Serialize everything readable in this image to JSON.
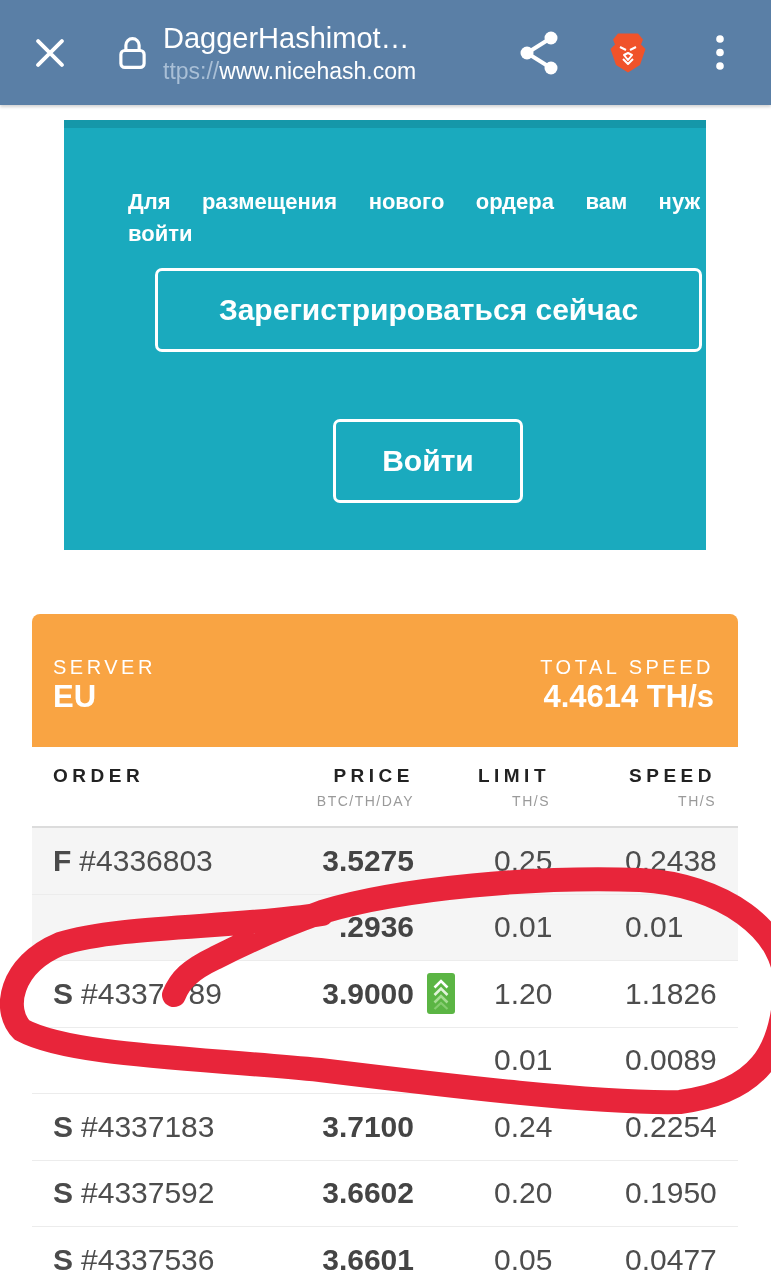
{
  "browser_bar": {
    "title": "DaggerHashimot…",
    "url_scheme": "ttps://",
    "url_host": "www.nicehash.com"
  },
  "banner": {
    "message_line_1": "Для размещения нового ордера вам нуж",
    "message_line_2": "войти",
    "buttons": [
      "Зарегистрироваться сейчас",
      "Войти"
    ]
  },
  "server_card": {
    "server_label": "SERVER",
    "server": "EU",
    "total_speed_label": "TOTAL SPEED",
    "total_speed": "4.4614 TH/s"
  },
  "table": {
    "columns": [
      {
        "title": "ORDER"
      },
      {
        "title": "PRICE",
        "unit": "BTC/TH/DAY"
      },
      {
        "title": "LIMIT",
        "unit": "TH/S"
      },
      {
        "title": "SPEED",
        "unit": "TH/S"
      }
    ],
    "rows": [
      {
        "side": "F",
        "order": "#4336803",
        "price": "3.5275",
        "boosted": false,
        "limit": "0.25",
        "speed": "0.2438",
        "shaded": true
      },
      {
        "price": ".2936",
        "boosted": false,
        "limit": "0.01",
        "speed": "0.01",
        "shaded": true
      },
      {
        "side": "S",
        "order": "#4337",
        "order_after_mark": "89",
        "price": "3.9000",
        "boosted": true,
        "limit": "1.20",
        "speed": "1.1826",
        "shaded": false
      },
      {
        "boosted": false,
        "limit": "0.01",
        "speed": "0.0089",
        "shaded": false
      },
      {
        "side": "S",
        "order": "#4337183",
        "price": "3.7100",
        "boosted": false,
        "limit": "0.24",
        "speed": "0.2254",
        "shaded": false
      },
      {
        "side": "S",
        "order": "#4337592",
        "price": "3.6602",
        "boosted": false,
        "limit": "0.20",
        "speed": "0.1950",
        "shaded": false
      },
      {
        "side": "S",
        "order": "#4337536",
        "price": "3.6601",
        "boosted": false,
        "limit": "0.05",
        "speed": "0.0477",
        "shaded": false
      }
    ]
  }
}
